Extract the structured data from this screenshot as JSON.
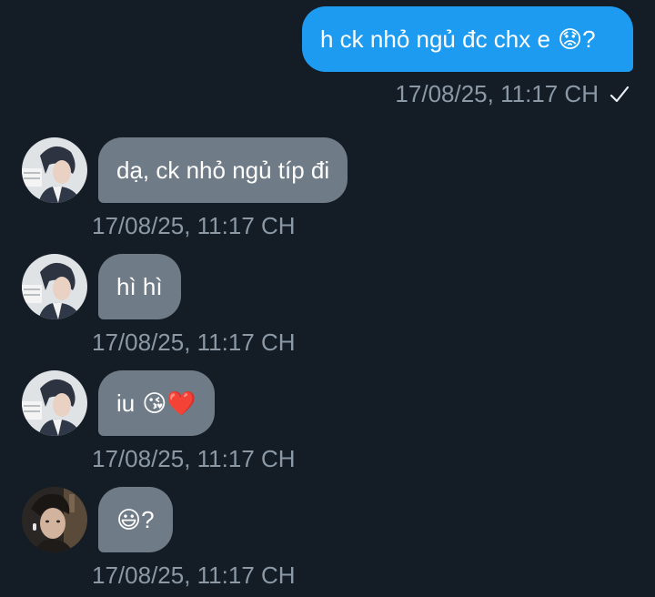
{
  "colors": {
    "background": "#141d26",
    "sent_bubble": "#1d9bf0",
    "received_bubble": "#6f7b87",
    "timestamp": "#8b98a5"
  },
  "messages": [
    {
      "direction": "sent",
      "text": "h ck nhỏ ngủ đc chx e",
      "emoji_suffix": "😟",
      "text_suffix": "?",
      "timestamp": "17/08/25, 11:17 CH",
      "status_icon": "check-icon"
    },
    {
      "direction": "received",
      "text": "dạ, ck nhỏ ngủ típ đi",
      "timestamp": "17/08/25, 11:17 CH",
      "avatar": "avatar-contact-1"
    },
    {
      "direction": "received",
      "text": "hì hì",
      "timestamp": "17/08/25, 11:17 CH",
      "avatar": "avatar-contact-1"
    },
    {
      "direction": "received",
      "text": "iu",
      "emoji_suffix": "😘❤️",
      "timestamp": "17/08/25, 11:17 CH",
      "avatar": "avatar-contact-1"
    },
    {
      "direction": "received",
      "text": "",
      "emoji_suffix": "😃",
      "text_suffix": "?",
      "timestamp": "17/08/25, 11:17 CH",
      "avatar": "avatar-contact-2"
    }
  ]
}
